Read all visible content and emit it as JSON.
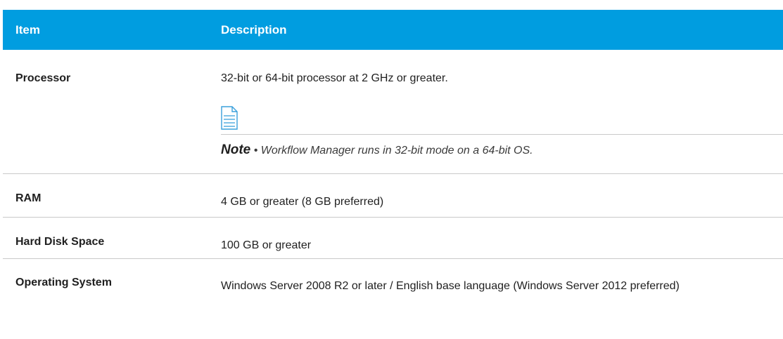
{
  "header": {
    "item": "Item",
    "description": "Description"
  },
  "rows": [
    {
      "item": "Processor",
      "description": "32-bit or 64-bit processor at 2 GHz or greater.",
      "note": {
        "icon": "note-icon",
        "label": "Note",
        "bullet": "•",
        "text": "Workflow Manager runs in 32-bit mode on a 64-bit OS."
      }
    },
    {
      "item": "RAM",
      "description": "4 GB or greater (8 GB preferred)"
    },
    {
      "item": "Hard Disk Space",
      "description": "100 GB or greater"
    },
    {
      "item": "Operating System",
      "description": "Windows Server 2008 R2 or later / English base language (Windows Server 2012 preferred)"
    }
  ],
  "colors": {
    "header_bg": "#009de0",
    "header_text": "#ffffff",
    "rule": "#c9c9c9",
    "note_icon": "#3aa0dc"
  }
}
